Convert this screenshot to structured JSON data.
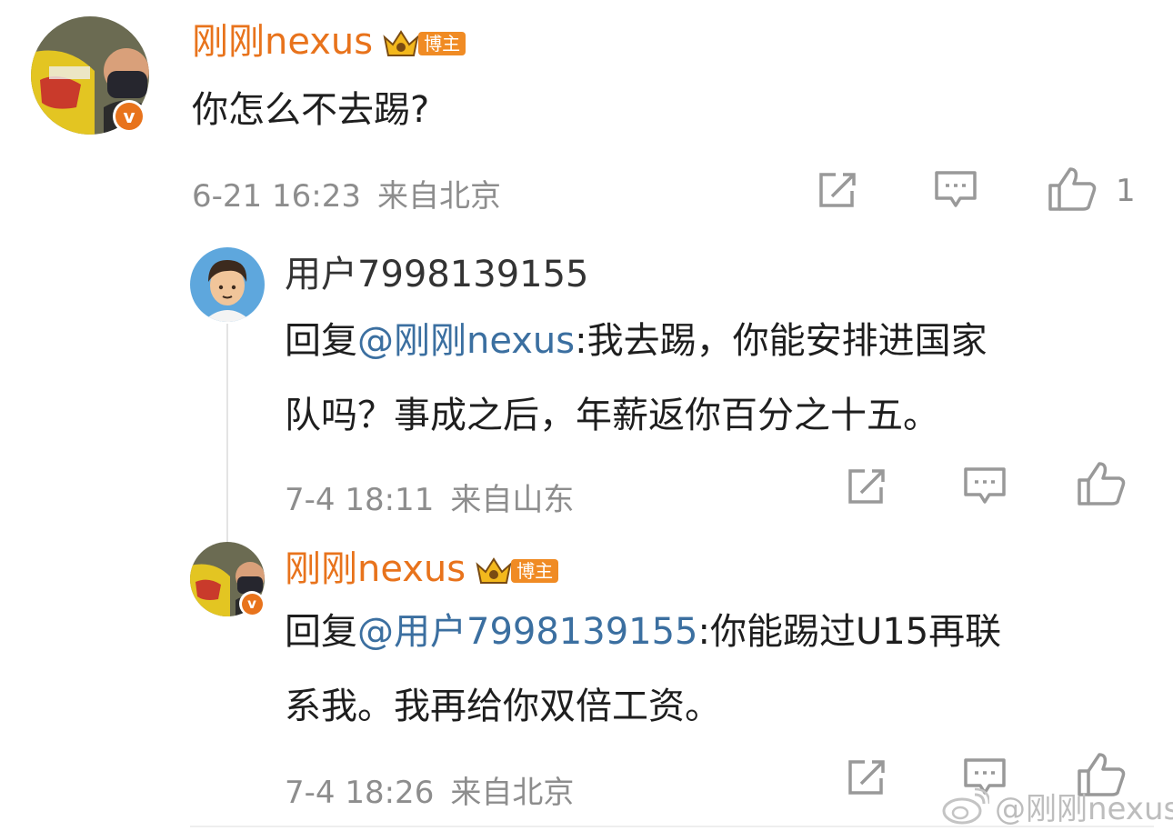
{
  "comment": {
    "author": "刚刚nexus",
    "badge_label": "博主",
    "text": "你怎么不去踢?",
    "time": "6-21 16:23",
    "location": "来自北京",
    "like_count": "1",
    "avatar_verified": "v"
  },
  "reply1": {
    "author": "用户7998139155",
    "prefix": "回复",
    "mention": "@刚刚nexus",
    "line1_rest": ":我去踢，你能安排进国家",
    "line2": "队吗？事成之后，年薪返你百分之十五。",
    "time": "7-4 18:11",
    "location": "来自山东"
  },
  "reply2": {
    "author": "刚刚nexus",
    "badge_label": "博主",
    "prefix": "回复",
    "mention": "@用户7998139155",
    "line1_rest": ":你能踢过U15再联",
    "line2": "系我。我再给你双倍工资。",
    "time": "7-4 18:26",
    "location": "来自北京",
    "avatar_verified": "v"
  },
  "watermark": {
    "text": "@刚刚nexus"
  },
  "colors": {
    "blogger_name": "#e8731c",
    "mention": "#3b6fa0",
    "meta_gray": "#8d8d8d",
    "verified": "#e8731c"
  },
  "icons": [
    "forward-icon",
    "comment-icon",
    "like-icon",
    "crown-icon",
    "verified-icon",
    "weibo-logo-icon"
  ]
}
